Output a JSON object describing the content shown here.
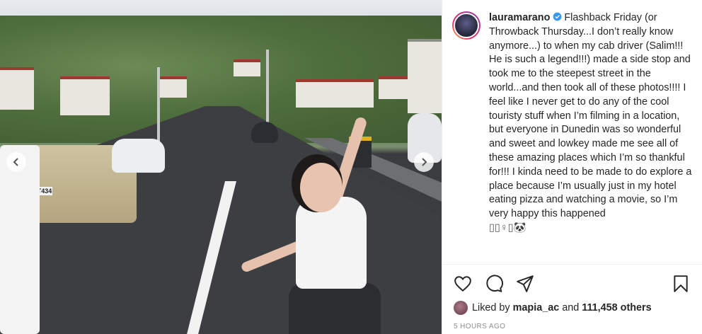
{
  "post": {
    "caption": {
      "username": "lauramarano",
      "text": "Flashback Friday (or Throwback Thursday...I don’t really know anymore...) to when my cab driver (Salim!!! He is such a legend!!!) made a side stop and took me to the steepest street in the world...and then took all of these photos!!!! I feel like I never get to do any of the cool touristy stuff when I’m filming in a location, but everyone in Dunedin was so wonderful and sweet and lowkey made me see all of these amazing places which I’m so thankful for!!! I kinda need to be made to do explore a place because I’m usually just in my hotel eating pizza and watching a movie, so I’m very happy this happened",
      "emoji_line": "▯▯♀▯🐼"
    },
    "photo": {
      "plate_text": "FHT434",
      "nav_prev": "previous-photo",
      "nav_next": "next-photo"
    },
    "likes": {
      "prefix": "Liked by",
      "liker": "mapia_ac",
      "conjunction": "and",
      "count_text": "111,458 others"
    },
    "timestamp": "5 HOURS AGO",
    "icons": [
      "heart-icon",
      "comment-icon",
      "share-icon",
      "bookmark-icon",
      "verified-badge-icon",
      "chevron-left-icon",
      "chevron-right-icon"
    ],
    "colors": {
      "verified": "#3897f0",
      "text": "#262626",
      "muted": "#8e8e8e"
    }
  }
}
